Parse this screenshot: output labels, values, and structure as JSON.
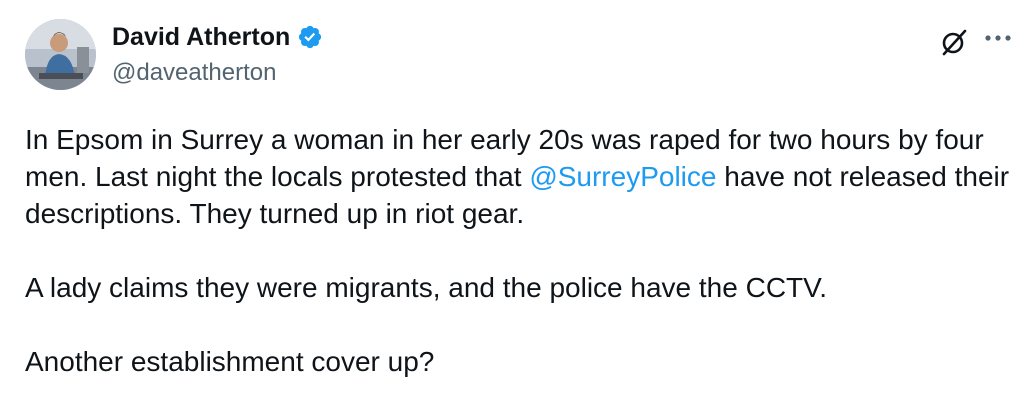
{
  "author": {
    "display_name": "David Atherton",
    "handle": "@daveatherton",
    "verified": true,
    "verified_color": "#1d9bf0",
    "avatar_icon": "user-avatar-photo"
  },
  "header_actions": {
    "grok_icon": "grok-slash-icon",
    "more_icon": "more-dots-icon"
  },
  "body": {
    "p1_before": "In Epsom in Surrey a woman in her early 20s was raped for two hours by four men. Last night the locals protested that ",
    "mention": "@SurreyPolice",
    "p1_after": " have not released their descriptions. They turned up in riot gear.",
    "p2": "A lady claims they were migrants, and the police have the CCTV.",
    "p3": "Another establishment cover up?"
  },
  "colors": {
    "text": "#0f1419",
    "secondary": "#536471",
    "link": "#1d9bf0"
  }
}
